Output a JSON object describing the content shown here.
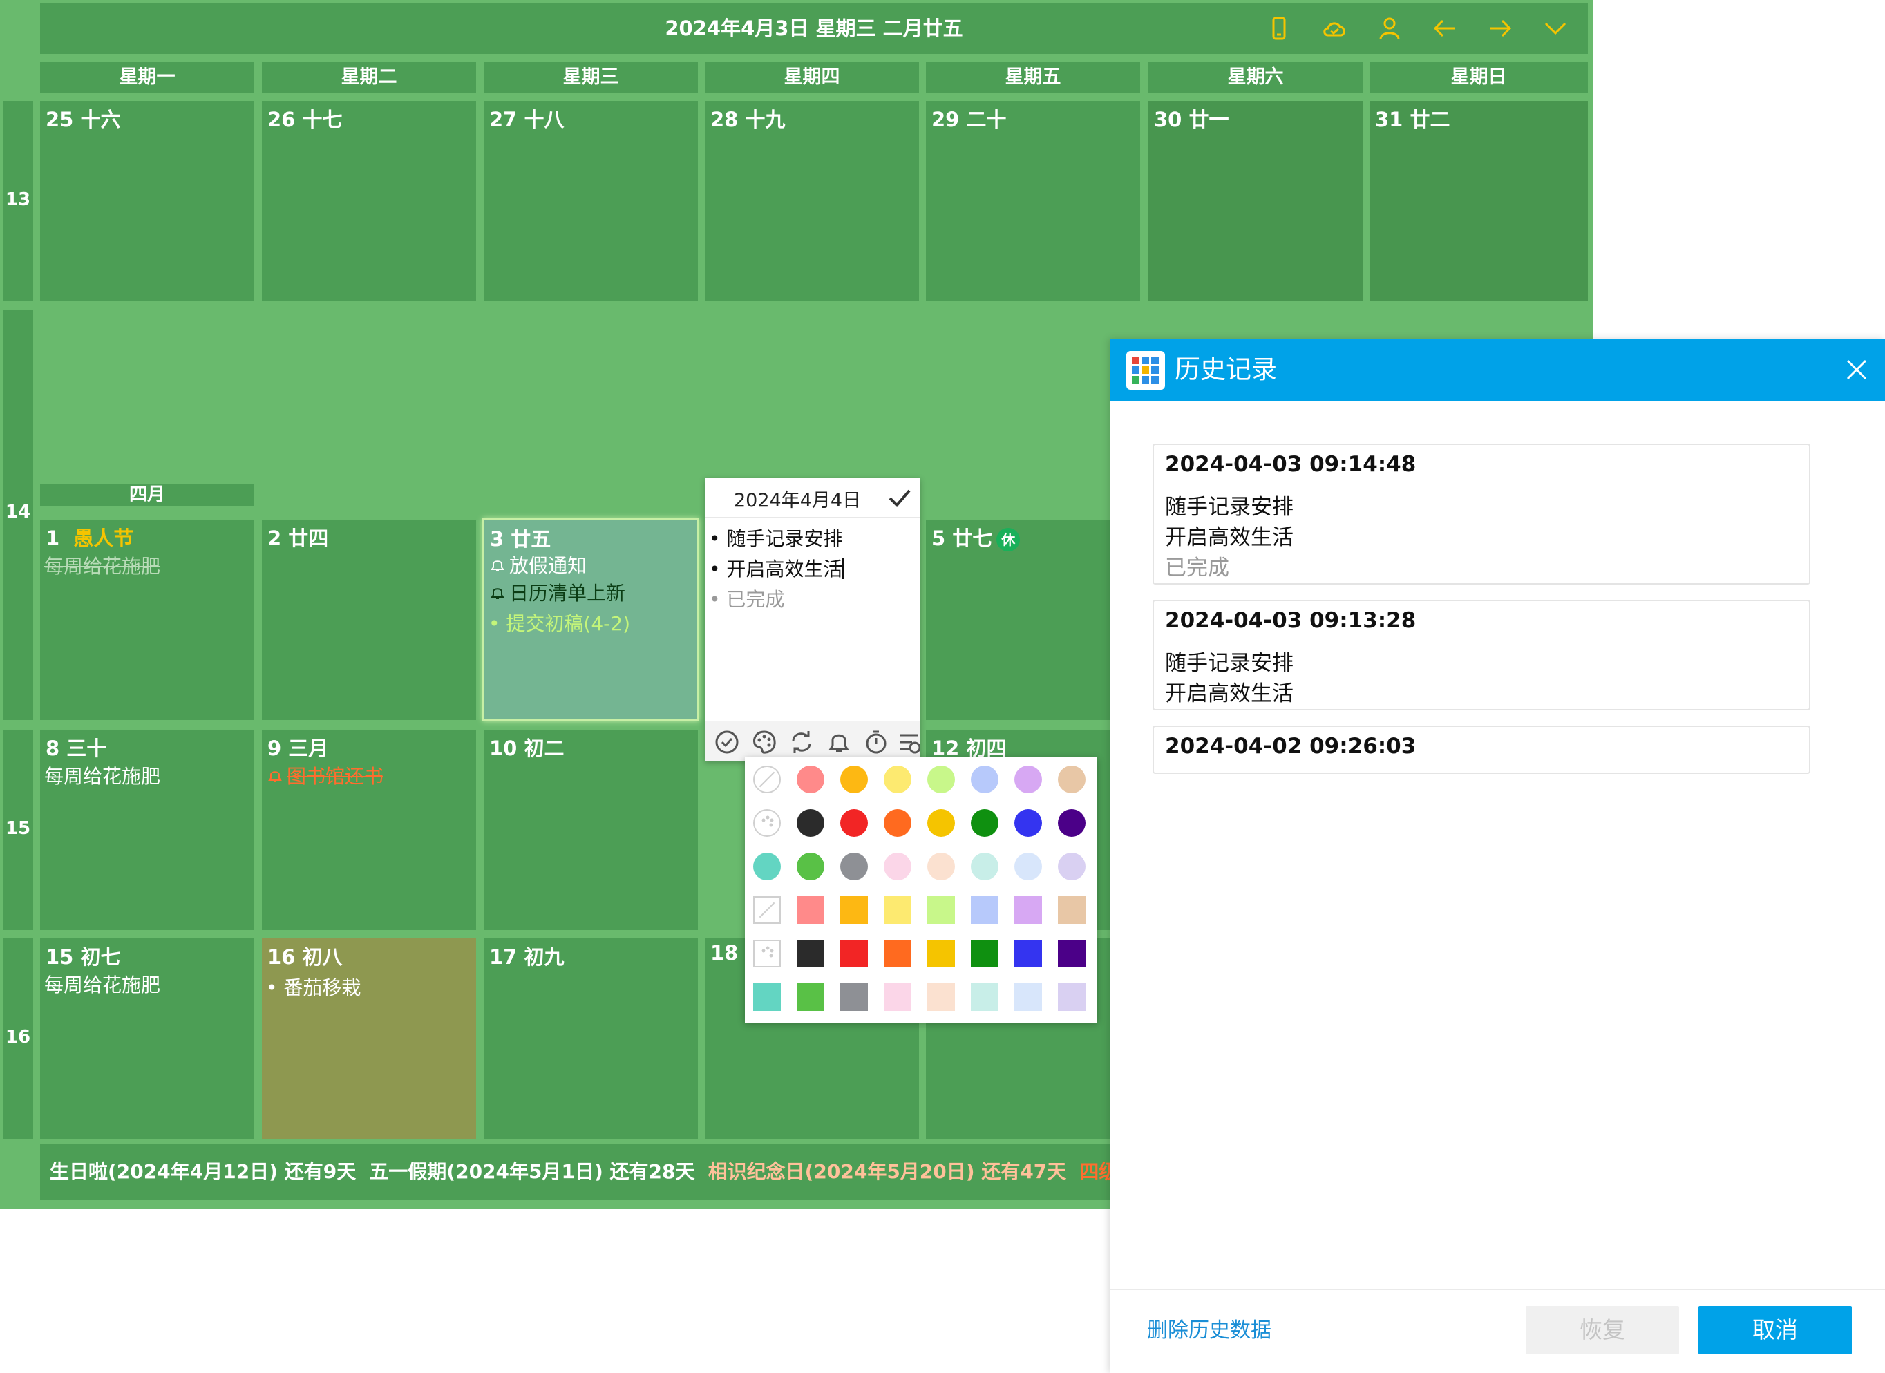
{
  "calendar": {
    "title": "2024年4月3日 星期三 二月廿五",
    "toolbar_icons": [
      "phone-icon",
      "cloud-sync-icon",
      "user-icon",
      "arrow-left-icon",
      "arrow-right-icon",
      "chevron-down-icon"
    ],
    "weekdays": [
      "星期一",
      "星期二",
      "星期三",
      "星期四",
      "星期五",
      "星期六",
      "星期日"
    ],
    "week_numbers": [
      "13",
      "14",
      "15",
      "16"
    ],
    "month_tag": "四月",
    "days": {
      "d25": "25 十六",
      "d26": "26 十七",
      "d27": "27 十八",
      "d28": "28 十九",
      "d29": "29 二十",
      "d30": "30 廿一",
      "d31": "31 廿二",
      "d1_num": "1",
      "d1_fest": "愚人节",
      "d2": "2 廿四",
      "d3": "3 廿五",
      "d5_num": "5 廿七",
      "d5_badge": "休",
      "d8": "8 三十",
      "d9": "9 三月",
      "d10": "10 初二",
      "d12": "12 初四",
      "d15": "15 初七",
      "d16": "16 初八",
      "d17": "17 初九",
      "d18": "18"
    },
    "events": {
      "d1_e1": "每周给花施肥",
      "d3_e1": "放假通知",
      "d3_e2": "日历清单上新",
      "d3_e3": "• 提交初稿(4-2)",
      "d8_e1": "每周给花施肥",
      "d9_e1": "图书馆还书",
      "d15_e1": "每周给花施肥",
      "d16_e1": "• 番茄移栽"
    },
    "ticker": [
      {
        "text": "生日啦(2024年4月12日) 还有9天",
        "color": "#ffffff"
      },
      {
        "text": "五一假期(2024年5月1日) 还有28天",
        "color": "#ffffff"
      },
      {
        "text": "相识纪念日(2024年5月20日) 还有47天",
        "color": "#ffc19a"
      },
      {
        "text": "四级考试(",
        "color": "#ff6d2e"
      }
    ],
    "colors": {
      "bg": "#69ba6d",
      "cell": "#4c9e55",
      "today": "#74b592",
      "highlight": "#8e9850"
    }
  },
  "editor": {
    "date": "2024年4月4日",
    "lines": [
      "• 随手记录安排",
      "• 开启高效生活",
      "• 已完成"
    ],
    "tools": [
      "check-circle-icon",
      "palette-icon",
      "repeat-icon",
      "bell-icon",
      "timer-icon",
      "more-icon"
    ]
  },
  "color_picker": {
    "circle_rows": [
      [
        "none",
        "#ff8a8a",
        "#fdb813",
        "#fdea70",
        "#c8f78a",
        "#b7c9fb",
        "#d7a8f3",
        "#e8c7a6"
      ],
      [
        "palette",
        "#2b2b2b",
        "#f22525",
        "#ff6a1f",
        "#f5c400",
        "#0f9010",
        "#3434f0",
        "#4b0088"
      ],
      [
        "#63d5c2",
        "#59c146",
        "#8e9095",
        "#fbd6e8",
        "#fbe1d0",
        "#c8eee8",
        "#d8e6fb",
        "#d9d0f2"
      ]
    ],
    "square_rows": [
      [
        "none",
        "#ff8a8a",
        "#fdb813",
        "#fdea70",
        "#c8f78a",
        "#b7c9fb",
        "#d7a8f3",
        "#e8c7a6"
      ],
      [
        "palette",
        "#2b2b2b",
        "#f22525",
        "#ff6a1f",
        "#f5c400",
        "#0f9010",
        "#3434f0",
        "#4b0088"
      ],
      [
        "#63d5c2",
        "#59c146",
        "#8e9095",
        "#fbd6e8",
        "#fbe1d0",
        "#c8eee8",
        "#d8e6fb",
        "#d9d0f2"
      ]
    ]
  },
  "history": {
    "title": "历史记录",
    "records": [
      {
        "timestamp": "2024-04-03 09:14:48",
        "lines": [
          "随手记录安排",
          "开启高效生活"
        ],
        "done": "已完成"
      },
      {
        "timestamp": "2024-04-03 09:13:28",
        "lines": [
          "随手记录安排",
          "开启高效生活"
        ]
      },
      {
        "timestamp": "2024-04-02 09:26:03",
        "lines": []
      }
    ],
    "delete_link": "删除历史数据",
    "restore_button": "恢复",
    "cancel_button": "取消",
    "accent": "#00a2e8"
  }
}
